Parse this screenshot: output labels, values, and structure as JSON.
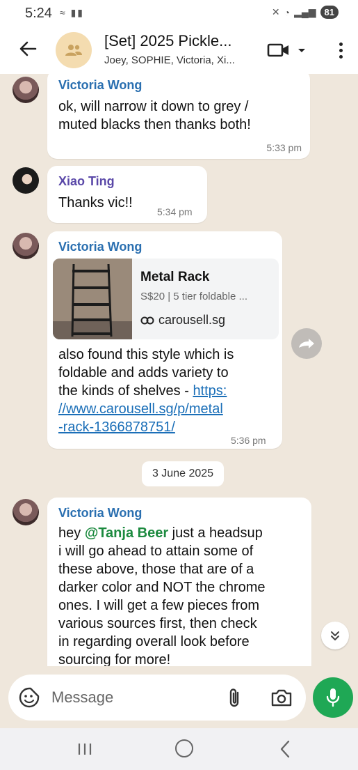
{
  "status_bar": {
    "time": "5:24",
    "battery": "81"
  },
  "header": {
    "title": "[Set] 2025 Pickle...",
    "members": "Joey, SOPHIE, Victoria, Xi..."
  },
  "messages": [
    {
      "sender": "Victoria Wong",
      "lines": [
        "ok, will narrow it down to grey /",
        "muted blacks then thanks both!"
      ],
      "time": "5:33 pm"
    },
    {
      "sender": "Xiao Ting",
      "lines": [
        "Thanks vic!!"
      ],
      "time": "5:34 pm"
    },
    {
      "sender": "Victoria Wong",
      "link_preview": {
        "title": "Metal Rack",
        "description": "S$20 | 5 tier foldable ...",
        "domain": "carousell.sg"
      },
      "lines": [
        "also found this style which is",
        "foldable and adds variety to",
        "the kinds of shelves - "
      ],
      "url_lines": [
        "https:",
        "//www.carousell.sg/p/metal",
        "-rack-1366878751/"
      ],
      "time": "5:36 pm"
    },
    {
      "sender": "Victoria Wong",
      "line_prefix": "hey ",
      "mention": "@Tanja Beer",
      "line_suffix": " just a headsup",
      "lines": [
        "i will go ahead to attain some of",
        "these above, those that are of a",
        "darker color and NOT the chrome",
        "ones. I will get a few pieces from",
        "various sources first, then check",
        "in regarding overall look before",
        "sourcing for more!"
      ]
    }
  ],
  "date_separator": "3 June 2025",
  "composer": {
    "placeholder": "Message"
  },
  "colors": {
    "accent_green": "#1fa855",
    "link_blue": "#1b6fb8",
    "sender_blue": "#2a6fb0",
    "mention_green": "#1c8a3f"
  }
}
